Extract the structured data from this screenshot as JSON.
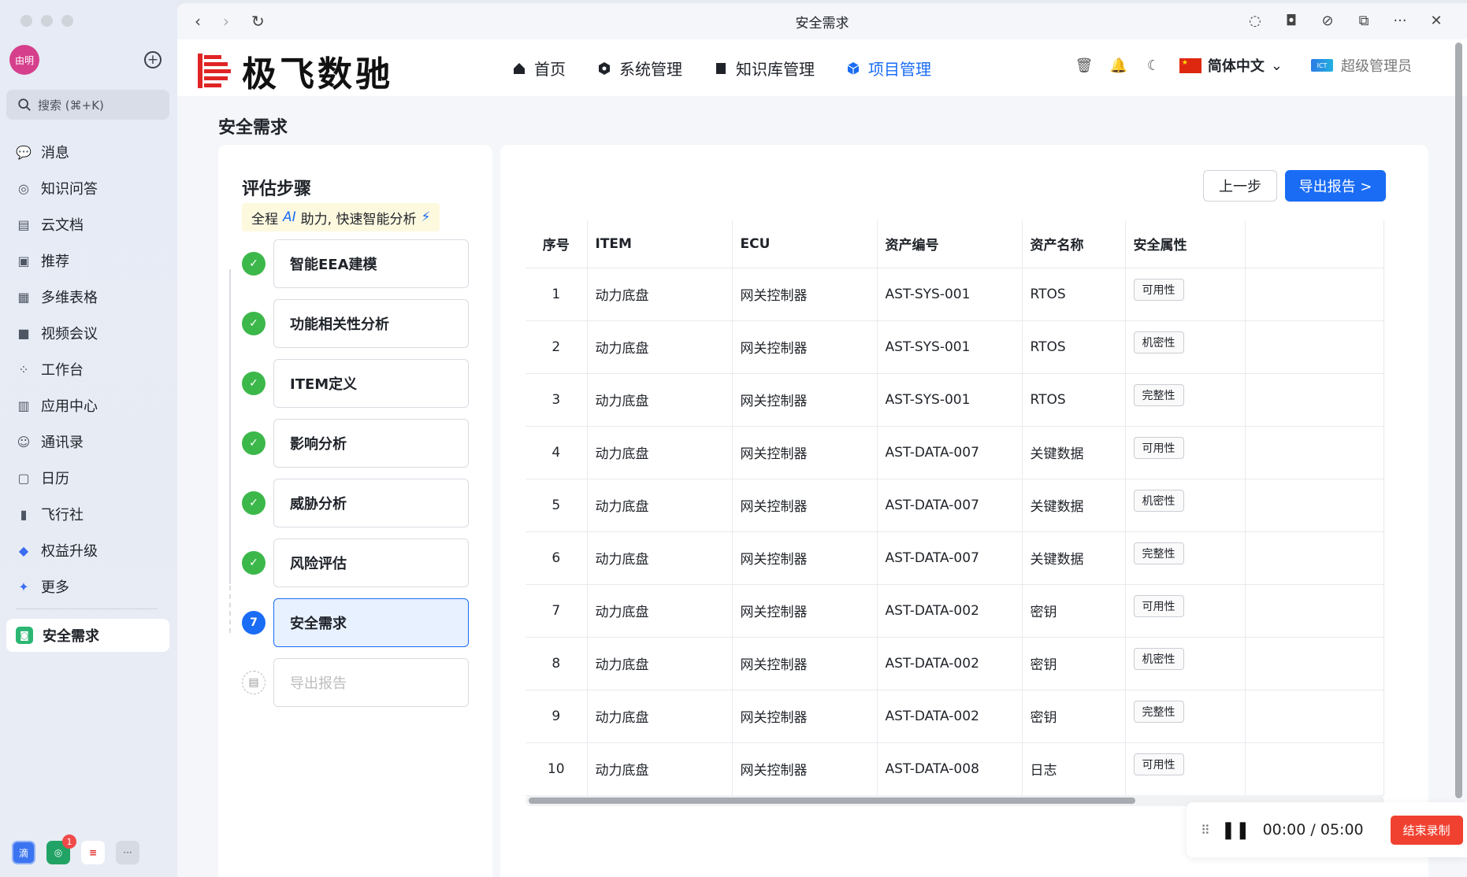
{
  "sidebar": {
    "avatar_text": "由明",
    "search_placeholder": "搜索 (⌘+K)",
    "items": [
      {
        "label": "消息",
        "icon": "message-icon"
      },
      {
        "label": "知识问答",
        "icon": "knowledge-qa-icon"
      },
      {
        "label": "云文档",
        "icon": "cloud-doc-icon"
      },
      {
        "label": "推荐",
        "icon": "recommend-icon"
      },
      {
        "label": "多维表格",
        "icon": "table-icon"
      },
      {
        "label": "视频会议",
        "icon": "video-icon"
      },
      {
        "label": "工作台",
        "icon": "workbench-icon"
      },
      {
        "label": "应用中心",
        "icon": "app-center-icon"
      },
      {
        "label": "通讯录",
        "icon": "contacts-icon"
      },
      {
        "label": "日历",
        "icon": "calendar-icon"
      },
      {
        "label": "飞行社",
        "icon": "community-icon"
      },
      {
        "label": "权益升级",
        "icon": "upgrade-icon"
      },
      {
        "label": "更多",
        "icon": "more-icon"
      }
    ],
    "active_item": "安全需求",
    "dock_badge": "1"
  },
  "window": {
    "title": "安全需求"
  },
  "header": {
    "brand": "极飞数驰",
    "nav": [
      {
        "label": "首页",
        "active": false
      },
      {
        "label": "系统管理",
        "active": false
      },
      {
        "label": "知识库管理",
        "active": false
      },
      {
        "label": "项目管理",
        "active": true
      }
    ],
    "language": "简体中文",
    "user": "超级管理员",
    "accent_color": "#1a6cf5"
  },
  "page": {
    "title": "安全需求"
  },
  "steps": {
    "title": "评估步骤",
    "tip_prefix": "全程",
    "tip_ai": "AI",
    "tip_suffix": "助力, 快速智能分析",
    "items": [
      {
        "label": "智能EEA建模",
        "status": "done"
      },
      {
        "label": "功能相关性分析",
        "status": "done"
      },
      {
        "label": "ITEM定义",
        "status": "done"
      },
      {
        "label": "影响分析",
        "status": "done"
      },
      {
        "label": "威胁分析",
        "status": "done"
      },
      {
        "label": "风险评估",
        "status": "done"
      },
      {
        "label": "安全需求",
        "status": "current",
        "number": "7"
      },
      {
        "label": "导出报告",
        "status": "todo"
      }
    ]
  },
  "table": {
    "prev_button": "上一步",
    "export_button": "导出报告 >",
    "columns": [
      "序号",
      "ITEM",
      "ECU",
      "资产编号",
      "资产名称",
      "安全属性"
    ],
    "rows": [
      [
        "1",
        "动力底盘",
        "网关控制器",
        "AST-SYS-001",
        "RTOS",
        "可用性"
      ],
      [
        "2",
        "动力底盘",
        "网关控制器",
        "AST-SYS-001",
        "RTOS",
        "机密性"
      ],
      [
        "3",
        "动力底盘",
        "网关控制器",
        "AST-SYS-001",
        "RTOS",
        "完整性"
      ],
      [
        "4",
        "动力底盘",
        "网关控制器",
        "AST-DATA-007",
        "关键数据",
        "可用性"
      ],
      [
        "5",
        "动力底盘",
        "网关控制器",
        "AST-DATA-007",
        "关键数据",
        "机密性"
      ],
      [
        "6",
        "动力底盘",
        "网关控制器",
        "AST-DATA-007",
        "关键数据",
        "完整性"
      ],
      [
        "7",
        "动力底盘",
        "网关控制器",
        "AST-DATA-002",
        "密钥",
        "可用性"
      ],
      [
        "8",
        "动力底盘",
        "网关控制器",
        "AST-DATA-002",
        "密钥",
        "机密性"
      ],
      [
        "9",
        "动力底盘",
        "网关控制器",
        "AST-DATA-002",
        "密钥",
        "完整性"
      ],
      [
        "10",
        "动力底盘",
        "网关控制器",
        "AST-DATA-008",
        "日志",
        "可用性"
      ]
    ]
  },
  "recorder": {
    "elapsed": "00:00",
    "separator": "/",
    "total": "05:00",
    "stop_label": "结束录制"
  }
}
